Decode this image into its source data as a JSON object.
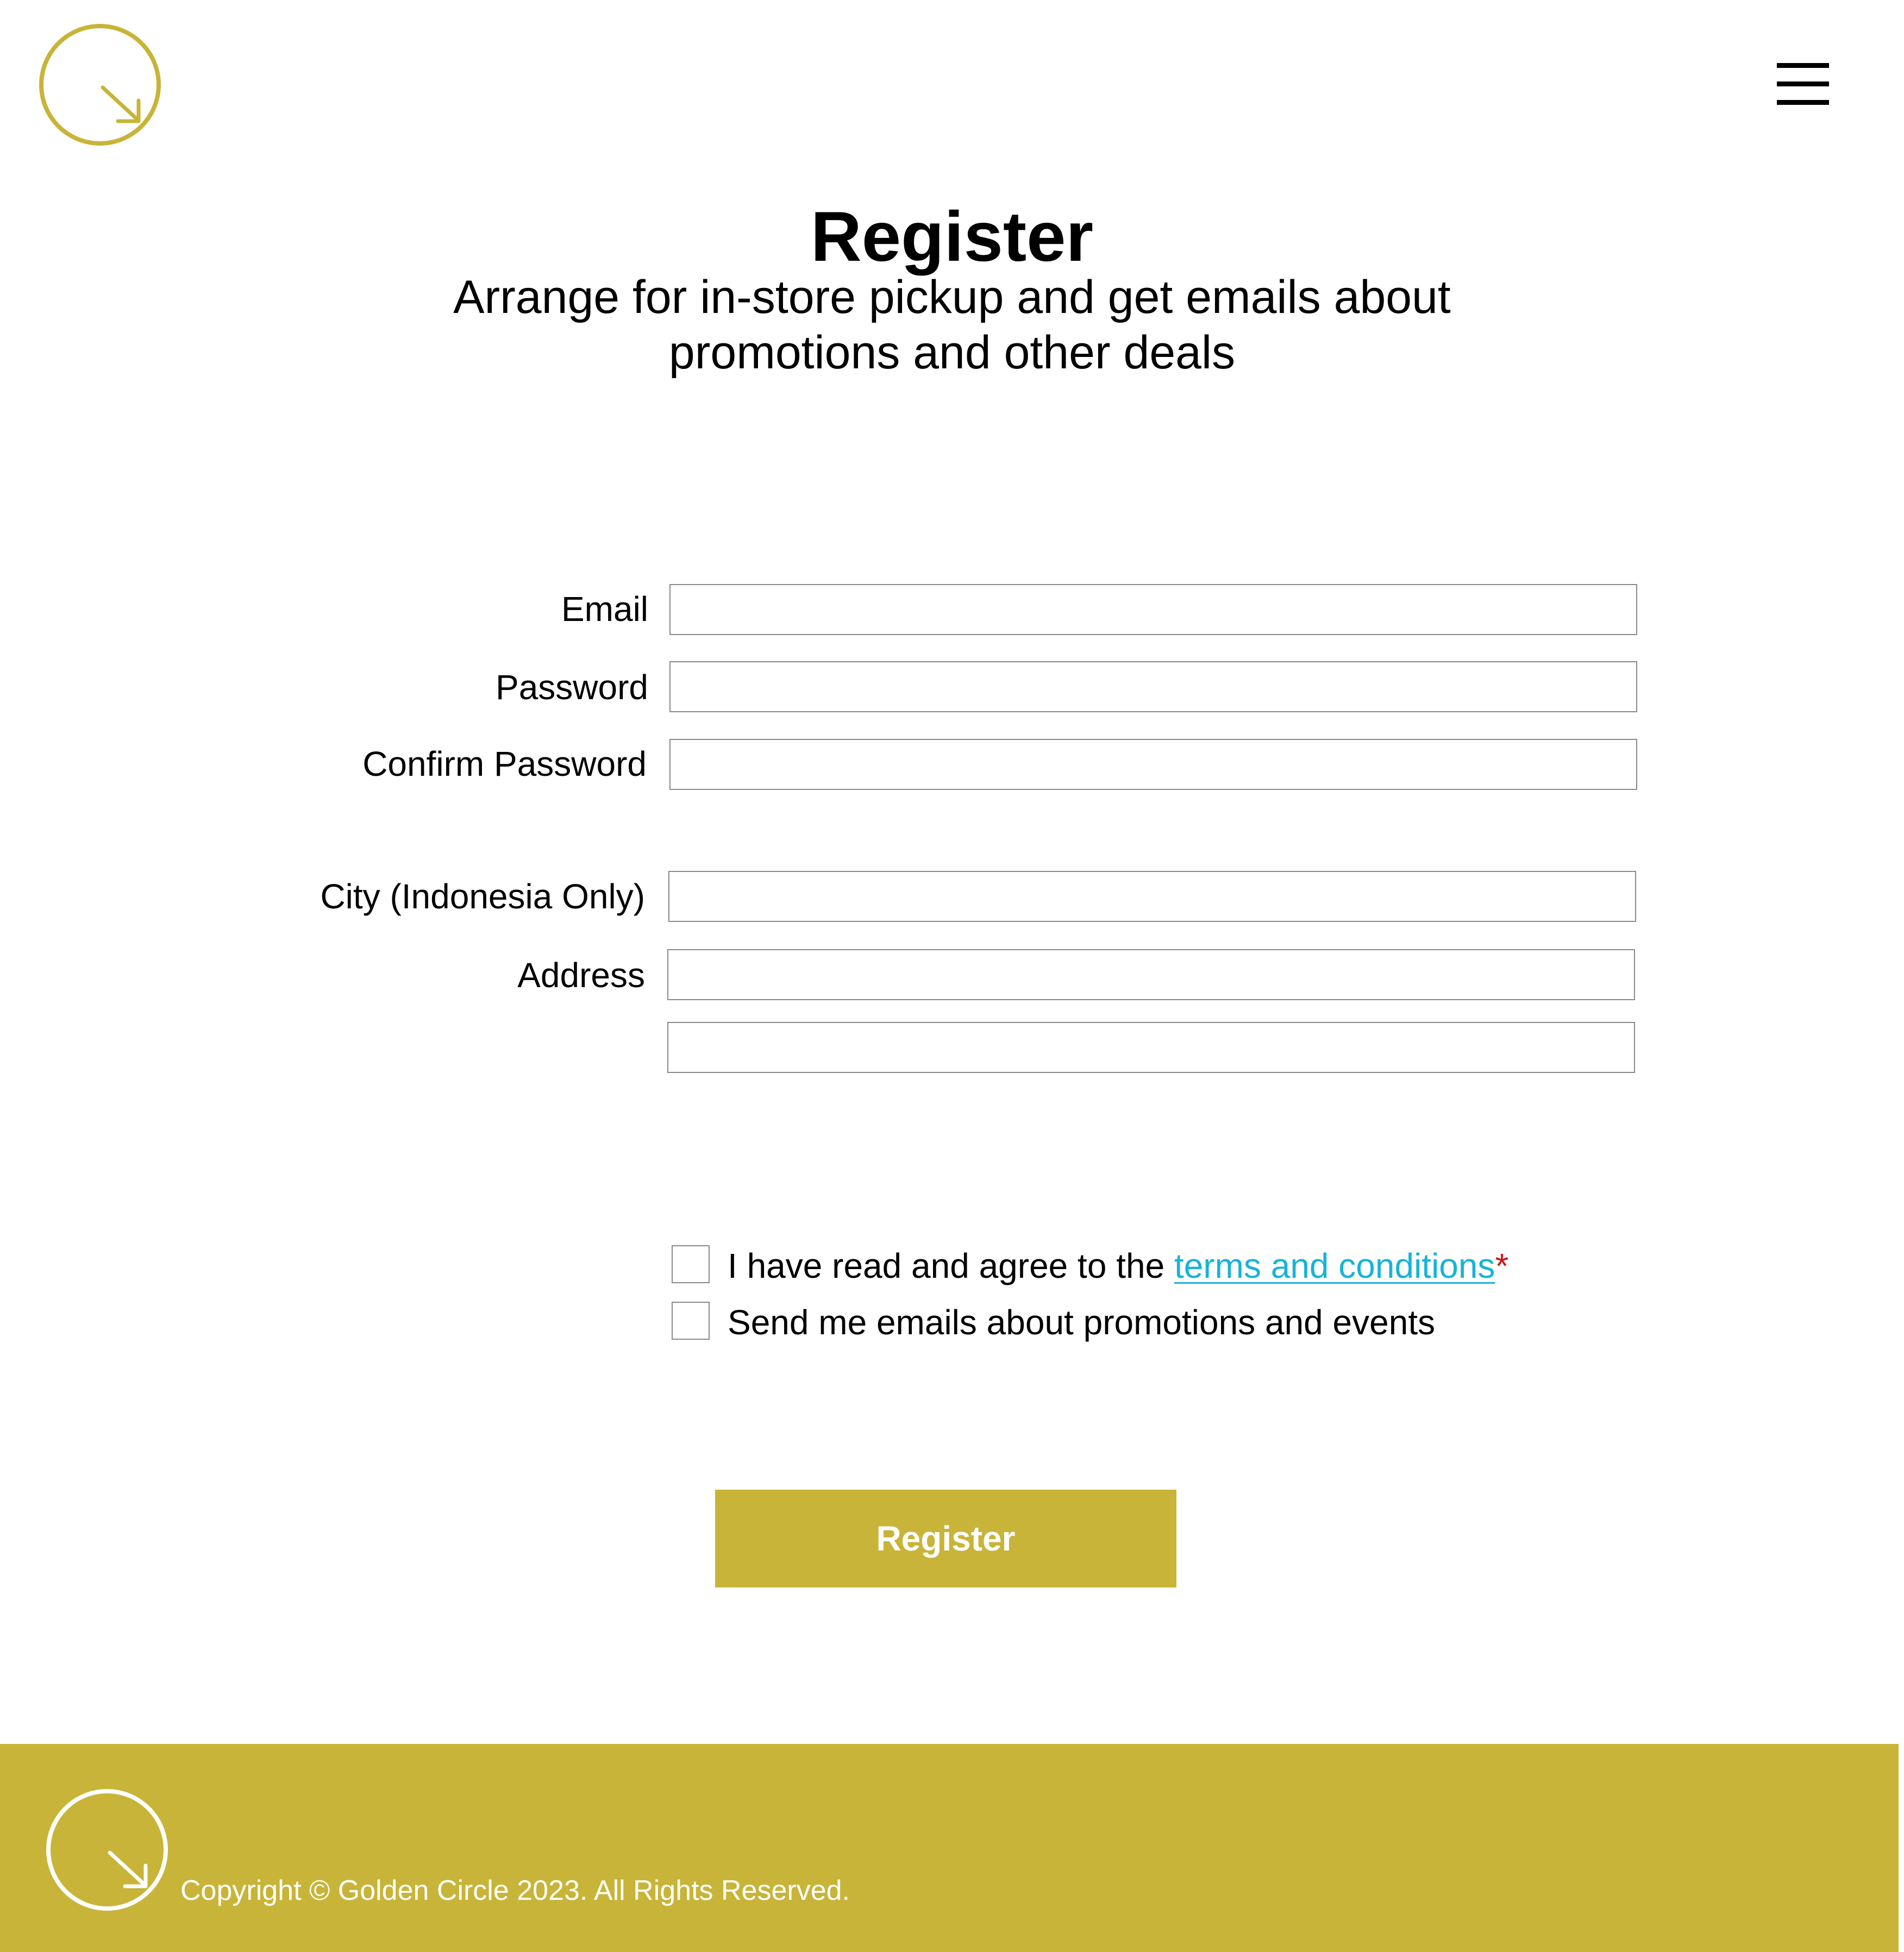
{
  "header": {
    "logo_icon": "circle-arrow-down-right-icon",
    "menu_icon": "hamburger-menu-icon",
    "brand_color": "#c8b438"
  },
  "page": {
    "title": "Register",
    "subtitle_line1": "Arrange for in-store pickup and get emails about",
    "subtitle_line2": "promotions and other deals"
  },
  "form": {
    "email_label": "Email",
    "email_value": "",
    "password_label": "Password",
    "password_value": "",
    "confirm_password_label": "Confirm Password",
    "confirm_password_value": "",
    "city_label": "City (Indonesia Only)",
    "city_value": "",
    "address_label": "Address",
    "address_line1_value": "",
    "address_line2_value": ""
  },
  "checkboxes": {
    "terms_prefix": "I have read and agree to the ",
    "terms_link": "terms and conditions",
    "terms_required_mark": "*",
    "terms_checked": false,
    "promo_label": "Send me emails about promotions and events",
    "promo_checked": false
  },
  "actions": {
    "register_label": "Register"
  },
  "footer": {
    "copyright": "Copyright ©  Golden Circle 2023. All Rights Reserved.",
    "logo_icon": "circle-arrow-down-right-icon",
    "background_color": "#c8b438"
  }
}
